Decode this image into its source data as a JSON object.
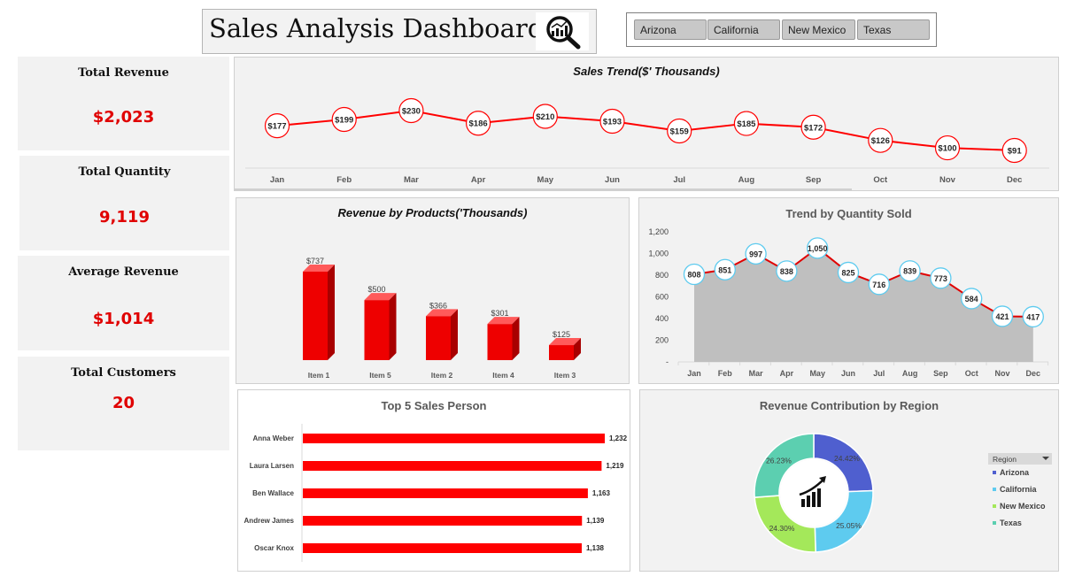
{
  "header": {
    "title": "Sales Analysis Dashboard"
  },
  "slicer": {
    "items": [
      "Arizona",
      "California",
      "New Mexico",
      "Texas"
    ]
  },
  "kpis": [
    {
      "label": "Total Revenue",
      "value": "$2,023"
    },
    {
      "label": "Total Quantity",
      "value": "9,119"
    },
    {
      "label": "Average Revenue",
      "value": "$1,014"
    },
    {
      "label": "Total  Customers",
      "value": "20"
    }
  ],
  "panels": {
    "sales_trend_title": "Sales Trend($' Thousands)",
    "products_title": "Revenue by Products('Thousands)",
    "quantity_title": "Trend by Quantity Sold",
    "salesperson_title": "Top 5 Sales Person",
    "region_title": "Revenue Contribution by Region",
    "region_legend_header": "Region"
  },
  "colors": {
    "accent": "#ff0000",
    "kpi_value": "#e00000",
    "panel_bg": "#f2f2f2",
    "area_fill": "#bfbfbf",
    "marker_blue": "#5ecbef",
    "arizona": "#4f5fcf",
    "california": "#5ecbef",
    "new_mexico": "#a4e85a",
    "texas": "#5ccfb0"
  },
  "chart_data": [
    {
      "type": "line",
      "title": "Sales Trend($' Thousands)",
      "categories": [
        "Jan",
        "Feb",
        "Mar",
        "Apr",
        "May",
        "Jun",
        "Jul",
        "Aug",
        "Sep",
        "Oct",
        "Nov",
        "Dec"
      ],
      "values": [
        177,
        199,
        230,
        186,
        210,
        193,
        159,
        185,
        172,
        126,
        100,
        91
      ],
      "labels": [
        "$177",
        "$199",
        "$230",
        "$186",
        "$210",
        "$193",
        "$159",
        "$185",
        "$172",
        "$126",
        "$100",
        "$91"
      ],
      "legend": "none"
    },
    {
      "type": "bar",
      "title": "Revenue by Products('Thousands)",
      "categories": [
        "Item 1",
        "Item 5",
        "Item 2",
        "Item 4",
        "Item 3"
      ],
      "values": [
        737,
        500,
        366,
        301,
        125
      ],
      "labels": [
        "$737",
        "$500",
        "$366",
        "$301",
        "$125"
      ]
    },
    {
      "type": "area",
      "title": "Trend by Quantity Sold",
      "categories": [
        "Jan",
        "Feb",
        "Mar",
        "Apr",
        "May",
        "Jun",
        "Jul",
        "Aug",
        "Sep",
        "Oct",
        "Nov",
        "Dec"
      ],
      "values": [
        808,
        851,
        997,
        838,
        1050,
        825,
        716,
        839,
        773,
        584,
        421,
        417
      ],
      "labels": [
        "808",
        "851",
        "997",
        "838",
        "1,050",
        "825",
        "716",
        "839",
        "773",
        "584",
        "421",
        "417"
      ],
      "ylim": [
        0,
        1200
      ],
      "yticks": [
        "-",
        "200",
        "400",
        "600",
        "800",
        "1,000",
        "1,200"
      ]
    },
    {
      "type": "bar",
      "orientation": "horizontal",
      "title": "Top 5 Sales Person",
      "categories": [
        "Anna Weber",
        "Laura Larsen",
        "Ben Wallace",
        "Andrew James",
        "Oscar Knox"
      ],
      "values": [
        1232,
        1219,
        1163,
        1139,
        1138
      ],
      "labels": [
        "1,232",
        "1,219",
        "1,163",
        "1,139",
        "1,138"
      ]
    },
    {
      "type": "pie",
      "donut": true,
      "title": "Revenue Contribution by Region",
      "categories": [
        "Arizona",
        "California",
        "New Mexico",
        "Texas"
      ],
      "values": [
        24.42,
        25.05,
        24.3,
        26.23
      ],
      "labels": [
        "24.42%",
        "25.05%",
        "24.30%",
        "26.23%"
      ],
      "legend": "right"
    }
  ]
}
